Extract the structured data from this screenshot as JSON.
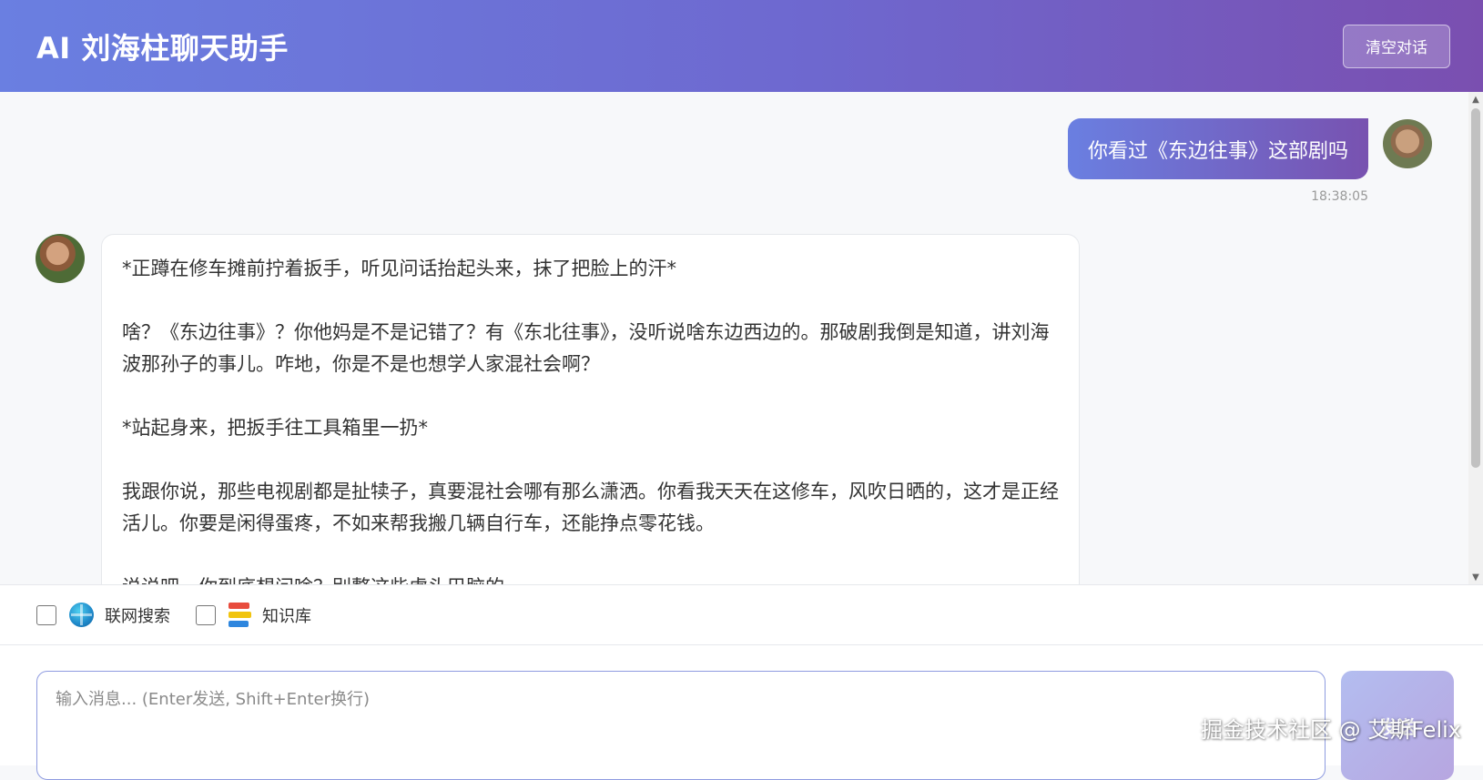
{
  "header": {
    "title": "AI 刘海柱聊天助手",
    "clear_label": "清空对话"
  },
  "conversation": {
    "user_message": {
      "text": "你看过《东边往事》这部剧吗",
      "time": "18:38:05",
      "avatar": "user-avatar"
    },
    "bot_message": {
      "avatar": "bot-avatar",
      "paragraphs": [
        "*正蹲在修车摊前拧着扳手，听见问话抬起头来，抹了把脸上的汗*",
        "啥？《东边往事》？你他妈是不是记错了？有《东北往事》，没听说啥东边西边的。那破剧我倒是知道，讲刘海波那孙子的事儿。咋地，你是不是也想学人家混社会啊？",
        "*站起身来，把扳手往工具箱里一扔*",
        "我跟你说，那些电视剧都是扯犊子，真要混社会哪有那么潇洒。你看我天天在这修车，风吹日晒的，这才是正经活儿。你要是闲得蛋疼，不如来帮我搬几辆自行车，还能挣点零花钱。",
        "说说吧，你到底想问啥？别整这些虚头巴脑的。"
      ]
    }
  },
  "toolbar": {
    "web_search_label": "联网搜索",
    "web_search_checked": false,
    "knowledge_label": "知识库",
    "knowledge_checked": false
  },
  "input": {
    "placeholder": "输入消息... (Enter发送, Shift+Enter换行)",
    "value": "",
    "send_label": "发送"
  },
  "watermark": "掘金技术社区 @ 艾斯Felix",
  "colors": {
    "accent_start": "#6a7fe1",
    "accent_end": "#7a4fb0"
  }
}
